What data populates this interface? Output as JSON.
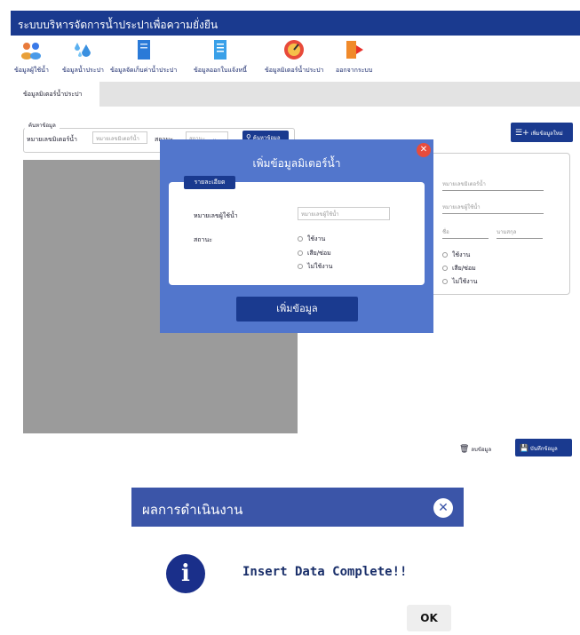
{
  "app": {
    "title": "ระบบบริหารจัดการน้ำประปาเพื่อความยั่งยืน"
  },
  "toolbar": {
    "items": [
      {
        "label": "ข้อมูลผู้ใช้น้ำ",
        "icon": "users-icon"
      },
      {
        "label": "ข้อมูลน้ำประปา",
        "icon": "water-drops-icon"
      },
      {
        "label": "ข้อมูลจัดเก็บค่าน้ำประปา",
        "icon": "document-icon"
      },
      {
        "label": "ข้อมูลออกใบแจ้งหนี้",
        "icon": "invoice-icon"
      },
      {
        "label": "ข้อมูลมิเตอร์น้ำประปา",
        "icon": "meter-gauge-icon"
      },
      {
        "label": "ออกจากระบบ",
        "icon": "logout-door-icon"
      }
    ]
  },
  "tabs": [
    {
      "label": "ข้อมูลมิเตอร์น้ำประปา"
    }
  ],
  "search": {
    "legend": "ค้นหาข้อมูล",
    "meter_label": "หมายเลขมิเตอร์น้ำ",
    "meter_placeholder": "หมายเลขมิเตอร์น้ำ",
    "status_label": "สถานะ",
    "status_value": "สถานะ",
    "button_label": "ค้นหาข้อมูล"
  },
  "right_panel": {
    "add_new_label": "เพิ่มข้อมูลใหม่",
    "meter_placeholder": "หมายเลขมิเตอร์น้ำ",
    "user_placeholder": "หมายเลขผู้ใช้น้ำ",
    "firstname_placeholder": "ชื่อ",
    "lastname_placeholder": "นามสกุล",
    "statuses": [
      "ใช้งาน",
      "เสีย/ซ่อม",
      "ไม่ใช้งาน"
    ]
  },
  "actions": {
    "delete_label": "ลบข้อมูล",
    "save_label": "บันทึกข้อมูล"
  },
  "modal": {
    "title": "เพิ่มข้อมูลมิเตอร์น้ำ",
    "detail_tab": "รายละเอียด",
    "user_label": "หมายเลขผู้ใช้น้ำ",
    "user_placeholder": "หมายเลขผู้ใช้น้ำ",
    "status_label": "สถานะ",
    "statuses": [
      "ใช้งาน",
      "เสีย/ซ่อม",
      "ไม่ใช้งาน"
    ],
    "submit_label": "เพิ่มข้อมูล"
  },
  "result_dialog": {
    "title": "ผลการดำเนินงาน",
    "message": "Insert Data Complete!!",
    "ok_label": "OK"
  },
  "colors": {
    "primary": "#1a3a8f",
    "modal": "#5276cc",
    "close": "#e74c3c",
    "dialog_header": "#3b55a8"
  }
}
